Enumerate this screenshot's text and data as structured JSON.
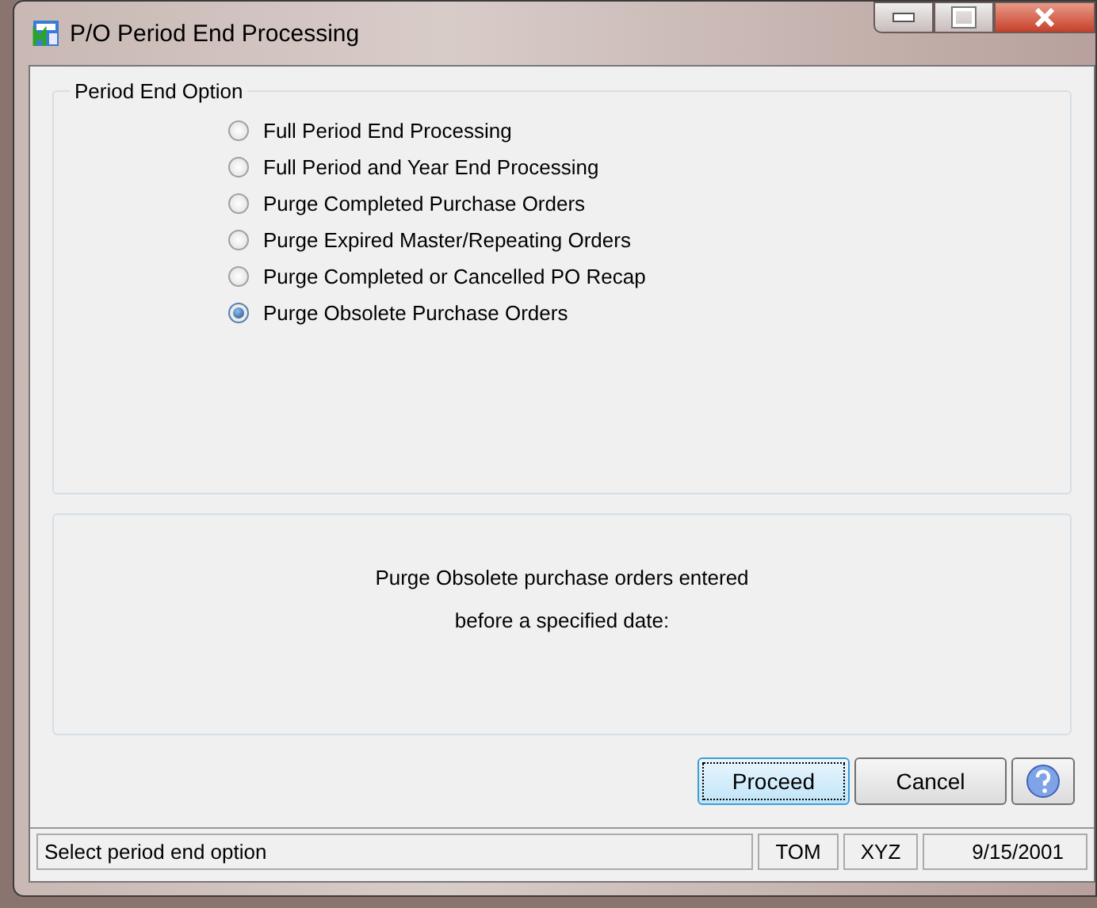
{
  "window": {
    "title": "P/O Period End Processing"
  },
  "option_group": {
    "title": "Period End Option",
    "options": [
      {
        "label": "Full Period End Processing",
        "selected": false
      },
      {
        "label": "Full Period and Year End Processing",
        "selected": false
      },
      {
        "label": "Purge Completed Purchase Orders",
        "selected": false
      },
      {
        "label": "Purge Expired Master/Repeating Orders",
        "selected": false
      },
      {
        "label": "Purge Completed or Cancelled PO Recap",
        "selected": false
      },
      {
        "label": "Purge Obsolete Purchase Orders",
        "selected": true
      }
    ]
  },
  "description": [
    "Purge Obsolete purchase orders entered",
    "before a specified date:"
  ],
  "buttons": [
    {
      "label": "Proceed",
      "focused": true
    },
    {
      "label": "Cancel",
      "focused": false
    }
  ],
  "status_bar": {
    "message": "Select period end option",
    "user": "TOM",
    "company": "XYZ",
    "date": "9/15/2001"
  }
}
